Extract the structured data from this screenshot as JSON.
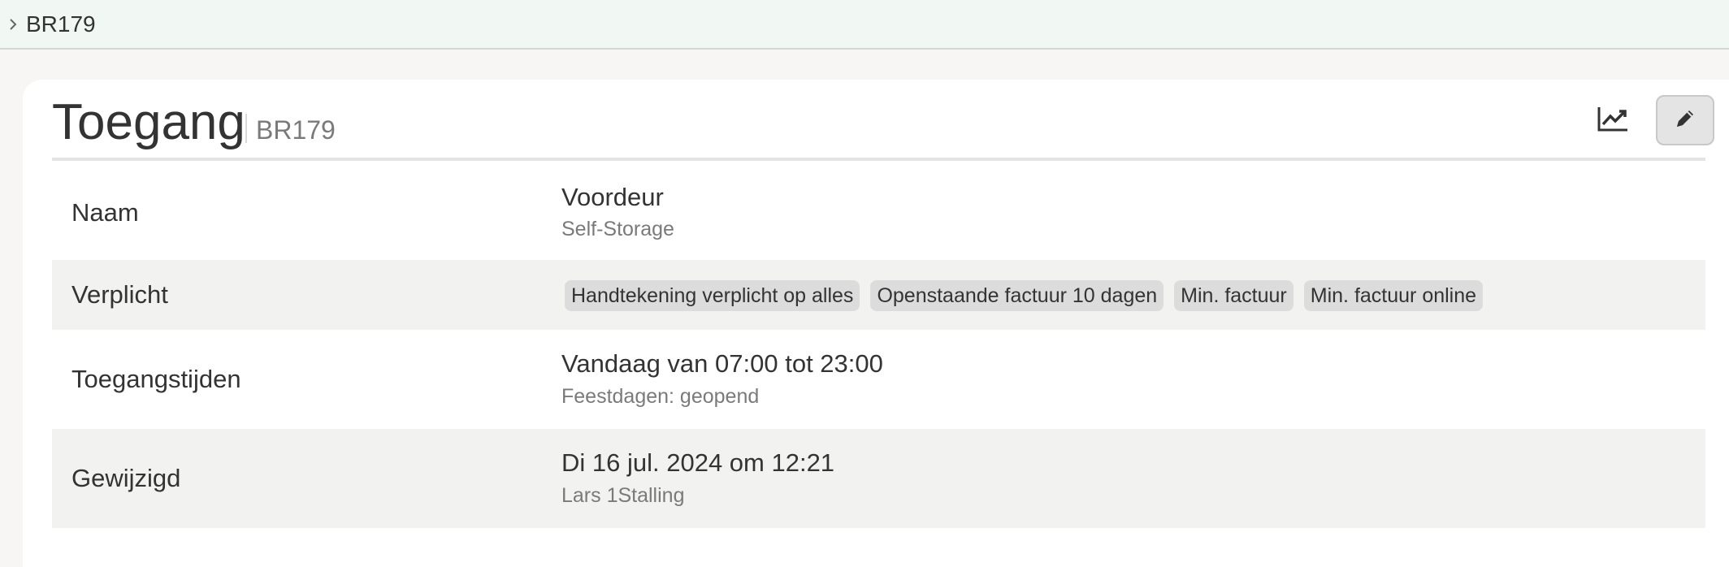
{
  "breadcrumb": {
    "label": "BR179"
  },
  "header": {
    "title": "Toegang",
    "subtitle": "BR179"
  },
  "actions": [
    {
      "name": "chart",
      "icon": "line-chart-icon"
    },
    {
      "name": "edit",
      "icon": "pencil-icon"
    }
  ],
  "rows": {
    "naam": {
      "label": "Naam",
      "value": "Voordeur",
      "sub": "Self-Storage"
    },
    "verplicht": {
      "label": "Verplicht",
      "tags": [
        "Handtekening verplicht op alles",
        "Openstaande factuur 10 dagen",
        "Min. factuur",
        "Min. factuur online"
      ]
    },
    "toegangstijden": {
      "label": "Toegangstijden",
      "value": "Vandaag van 07:00 tot 23:00",
      "sub": "Feestdagen: geopend"
    },
    "gewijzigd": {
      "label": "Gewijzigd",
      "value": "Di 16 jul. 2024 om 12:21",
      "sub": "Lars 1Stalling"
    }
  },
  "colors": {
    "topbar_bg": "#f1f8f4",
    "page_bg": "#f7f6f4",
    "row_alt_bg": "#f2f2f1",
    "tag_bg": "#dcdcdc",
    "muted_text": "#7a7a7a"
  }
}
